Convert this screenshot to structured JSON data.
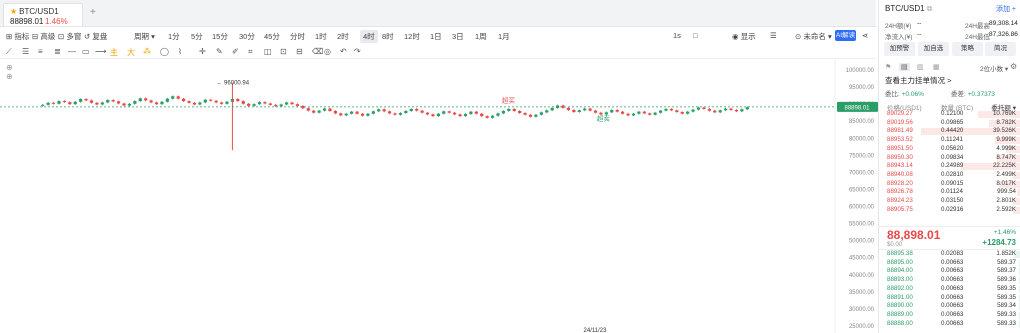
{
  "tab": {
    "symbol": "BTC/USD1",
    "price": "88898.01",
    "change": "1.46%",
    "add": "+"
  },
  "toolbar": {
    "items": [
      "指标",
      "高级",
      "多窗",
      "复盘",
      "周期"
    ],
    "intervals": [
      "1分",
      "5分",
      "15分",
      "30分",
      "45分",
      "分时",
      "1时",
      "2时",
      "4时",
      "8时",
      "12时",
      "1日",
      "3日",
      "1周",
      "1月"
    ],
    "active_interval": "4时",
    "right": [
      "1s",
      "□",
      "显示",
      "☰",
      "未命名",
      "AI解读"
    ]
  },
  "chart_data": {
    "type": "candlestick",
    "y_ticks": [
      "100000.00",
      "95000.00",
      "90000.00",
      "88898.01",
      "85000.00",
      "80000.00",
      "75000.00",
      "70000.00",
      "65000.00",
      "60000.00",
      "55000.00",
      "50000.00",
      "45000.00",
      "40000.00",
      "35000.00",
      "30000.00",
      "25000.00"
    ],
    "ylim": [
      25000,
      100000
    ],
    "last_price": 88898.01,
    "annotations": [
      {
        "text": "96000.94"
      },
      {
        "text": "超买"
      },
      {
        "text": "超卖"
      }
    ],
    "x_tick": "24/11/23",
    "closes": [
      89500,
      90100,
      89800,
      90600,
      90300,
      89700,
      90400,
      91200,
      90800,
      90100,
      89600,
      90200,
      90900,
      90500,
      89900,
      89300,
      89800,
      90600,
      91400,
      90800,
      90200,
      89700,
      90400,
      91300,
      92000,
      91300,
      90600,
      90100,
      89600,
      90200,
      91000,
      90700,
      90200,
      89800,
      90400,
      91200,
      90600,
      89800,
      89200,
      89700,
      90300,
      89900,
      89500,
      89100,
      89600,
      90200,
      89700,
      89200,
      88500,
      87800,
      87200,
      87800,
      88400,
      87700,
      87000,
      86400,
      86900,
      87500,
      86900,
      86300,
      86900,
      87600,
      88200,
      87600,
      87000,
      86600,
      87100,
      87700,
      88300,
      87800,
      87200,
      86700,
      86200,
      86900,
      87600,
      87200,
      86700,
      86200,
      86800,
      87500,
      86900,
      86200,
      85700,
      86300,
      87000,
      87700,
      88300,
      87700,
      87100,
      86600,
      86000,
      86600,
      87300,
      87900,
      88600,
      89300,
      88600,
      88000,
      87400,
      87900,
      88400,
      87800,
      87200,
      86700,
      87300,
      88000,
      87500,
      86900,
      86400,
      86900,
      87500,
      87000,
      86600,
      87200,
      87800,
      88300,
      87900,
      87400,
      86900,
      87500,
      88100,
      88700,
      88300,
      87800,
      87300,
      87900,
      88400,
      88000,
      87600,
      88200,
      88800
    ]
  },
  "panel": {
    "title": "BTC/USD1",
    "copy": "⧉",
    "fav": "添加 +",
    "high_label": "24H最高",
    "high": "89,308.14",
    "low_label": "24H最低",
    "low": "87,326.86",
    "vol_label": "24H额(¥)",
    "vol": "--",
    "inflow_label": "净流入(¥)",
    "inflow": "--",
    "buttons": [
      "加预警",
      "加自选",
      "策略",
      "简况"
    ],
    "precision": "2位小数 ▾",
    "subtitle": "查看主力挂单情况 >",
    "ratio_buy_label": "委比:",
    "ratio_buy": "+0.06%",
    "ratio_sell_label": "委差:",
    "ratio_sell": "+0.37373",
    "headers": [
      "价格(USD1)",
      "数量 (BTC)",
      "委托额 ▾"
    ],
    "asks": [
      {
        "p": "89029.27",
        "q": "0.12100",
        "c": "10.769K",
        "w": 30
      },
      {
        "p": "89019.56",
        "q": "0.09865",
        "c": "8.782K",
        "w": 22
      },
      {
        "p": "88981.49",
        "q": "0.44420",
        "c": "39.526K",
        "w": 70
      },
      {
        "p": "88953.52",
        "q": "0.11241",
        "c": "9.999K",
        "w": 18
      },
      {
        "p": "88951.50",
        "q": "0.05620",
        "c": "4.999K",
        "w": 10
      },
      {
        "p": "88950.30",
        "q": "0.09834",
        "c": "8.747K",
        "w": 16
      },
      {
        "p": "88943.14",
        "q": "0.24989",
        "c": "22.225K",
        "w": 42
      },
      {
        "p": "88940.08",
        "q": "0.02810",
        "c": "2.499K",
        "w": 5
      },
      {
        "p": "88928.20",
        "q": "0.09015",
        "c": "8.017K",
        "w": 15
      },
      {
        "p": "88926.78",
        "q": "0.01124",
        "c": "999.54",
        "w": 2
      },
      {
        "p": "88924.23",
        "q": "0.03150",
        "c": "2.801K",
        "w": 5
      },
      {
        "p": "88905.75",
        "q": "0.02916",
        "c": "2.592K",
        "w": 5
      }
    ],
    "mid_price": "88,898.01",
    "mid_usd": "$0.00",
    "mid_pct": "+1.46%",
    "mid_change": "+1284.73",
    "bids": [
      {
        "p": "88895.38",
        "q": "0.02083",
        "c": "1.852K",
        "w": 4
      },
      {
        "p": "88895.00",
        "q": "0.00663",
        "c": "589.37",
        "w": 1
      },
      {
        "p": "88894.00",
        "q": "0.00663",
        "c": "589.37",
        "w": 1
      },
      {
        "p": "88893.00",
        "q": "0.00663",
        "c": "589.36",
        "w": 1
      },
      {
        "p": "88892.00",
        "q": "0.00663",
        "c": "589.35",
        "w": 1
      },
      {
        "p": "88891.00",
        "q": "0.00663",
        "c": "589.35",
        "w": 1
      },
      {
        "p": "88890.00",
        "q": "0.00663",
        "c": "589.34",
        "w": 1
      },
      {
        "p": "88889.00",
        "q": "0.00663",
        "c": "589.33",
        "w": 1
      },
      {
        "p": "88888.00",
        "q": "0.00663",
        "c": "589.33",
        "w": 1
      }
    ]
  }
}
